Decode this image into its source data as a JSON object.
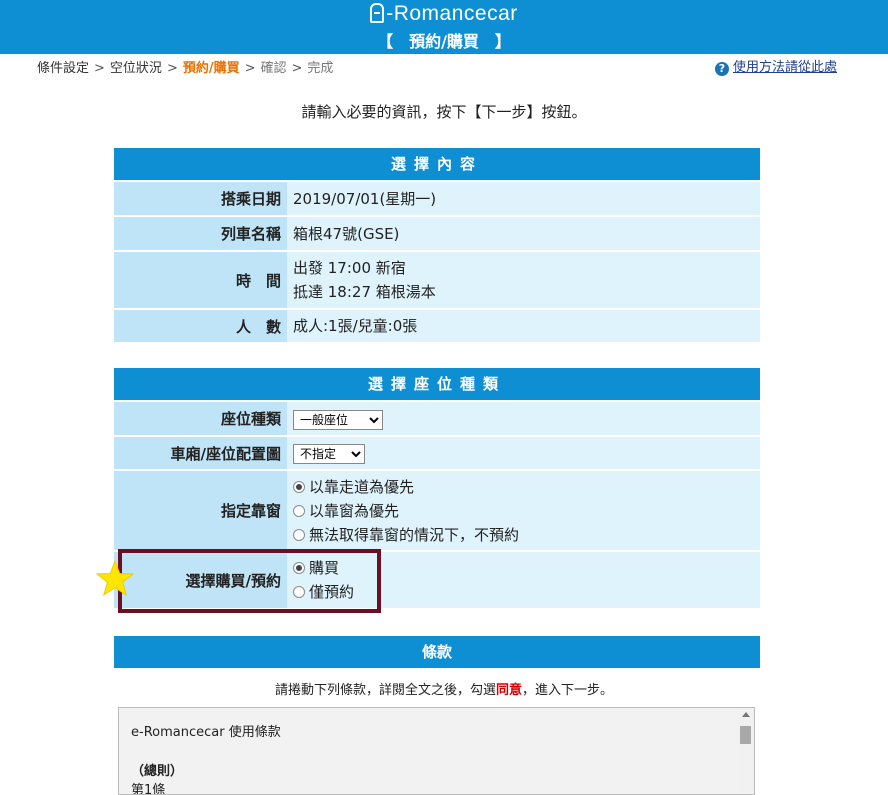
{
  "header": {
    "brand": "e-Romancecar",
    "brand_text": "-Romancecar",
    "heading": "【　預約/購買　】"
  },
  "breadcrumb": {
    "items": [
      "條件設定",
      "空位狀況",
      "預約/購買",
      "確認",
      "完成"
    ],
    "separator": ">"
  },
  "help": {
    "icon": "question-circle-icon",
    "label": "使用方法請從此處"
  },
  "instruction": "請輸入必要的資訊，按下【下一步】按鈕。",
  "selection": {
    "title": "選擇內容",
    "rows": [
      {
        "label": "搭乘日期",
        "value": "2019/07/01(星期一)"
      },
      {
        "label": "列車名稱",
        "value": "箱根47號(GSE)"
      },
      {
        "label": "時　間",
        "line1": "出發 17:00  新宿",
        "line2": "抵達 18:27  箱根湯本"
      },
      {
        "label": "人　數",
        "value": "成人:1張/兒童:0張"
      }
    ]
  },
  "seat": {
    "title": "選擇座位種類",
    "seat_type_label": "座位種類",
    "seat_type_value": "一般座位",
    "car_label": "車廂/座位配置圖",
    "car_value": "不指定",
    "window_label": "指定靠窗",
    "window_options": [
      "以靠走道為優先",
      "以靠窗為優先",
      "無法取得靠窗的情況下，不預約"
    ],
    "window_selected": 0,
    "purchase_label": "選擇購買/預約",
    "purchase_options": [
      "購買",
      "僅預約"
    ],
    "purchase_selected": 0
  },
  "terms": {
    "title": "條款",
    "note_before": "請捲動下列條款，詳閱全文之後，勾選",
    "note_agree": "同意",
    "note_after": "，進入下一步。",
    "body_title": "e-Romancecar 使用條款",
    "section": "（總則）",
    "article": "第1條"
  },
  "colors": {
    "header_blue": "#0f8fd3",
    "label_bg": "#bfe4f7",
    "value_bg": "#def3fc",
    "current_step": "#ee6f00",
    "highlight_border": "#6b0f25",
    "star": "#ffe600",
    "agree_red": "#d40000"
  }
}
